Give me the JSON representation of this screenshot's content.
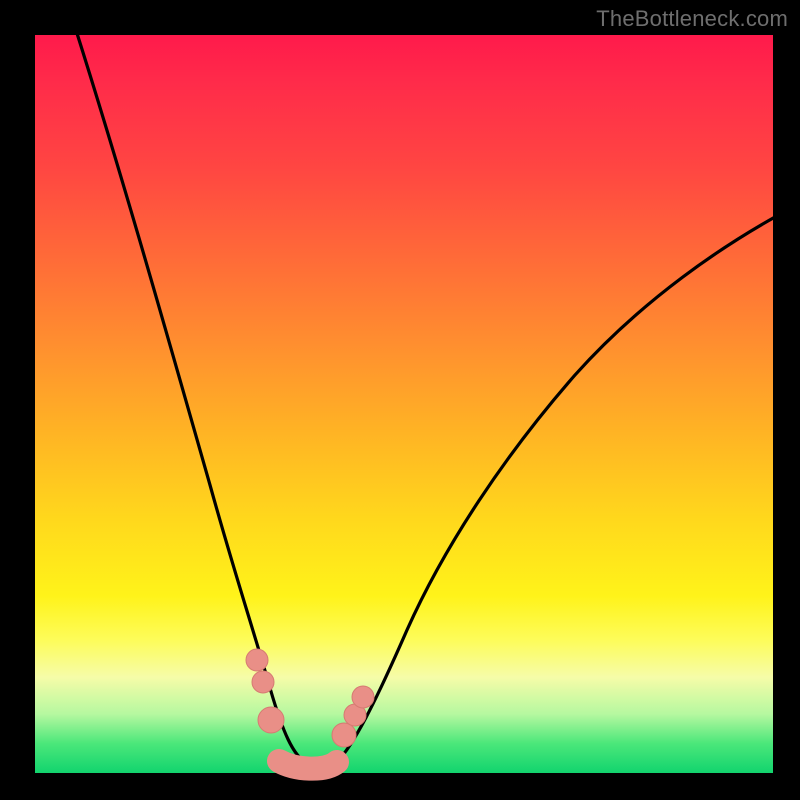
{
  "watermark": "TheBottleneck.com",
  "colors": {
    "frame": "#000000",
    "curve": "#000000",
    "marker_fill": "#e98f87",
    "marker_stroke": "#d67a72",
    "gradient_top": "#ff1a4b",
    "gradient_bottom": "#12d46e"
  },
  "chart_data": {
    "type": "line",
    "title": "",
    "xlabel": "",
    "ylabel": "",
    "xlim": [
      0,
      100
    ],
    "ylim": [
      0,
      100
    ],
    "grid": false,
    "series": [
      {
        "name": "curve-left",
        "x": [
          10,
          14,
          18,
          22,
          25,
          27,
          29,
          31,
          32.5,
          33.5,
          35
        ],
        "y": [
          100,
          81,
          64,
          49,
          36,
          27,
          20,
          13,
          7,
          4,
          1
        ]
      },
      {
        "name": "curve-right",
        "x": [
          40,
          42,
          44,
          47,
          50,
          55,
          60,
          67,
          75,
          85,
          95,
          100
        ],
        "y": [
          1,
          4,
          8,
          14,
          20,
          29,
          37,
          46,
          54,
          63,
          71,
          75
        ]
      }
    ],
    "markers": [
      {
        "x": 30.5,
        "y": 15,
        "r": 1.6
      },
      {
        "x": 31.3,
        "y": 12,
        "r": 1.6
      },
      {
        "x": 32.3,
        "y": 6.5,
        "r": 2.0
      },
      {
        "x": 33.5,
        "y": 3.2,
        "r": 2.4
      },
      {
        "x": 35.0,
        "y": 1.4,
        "r": 2.4
      },
      {
        "x": 36.8,
        "y": 0.8,
        "r": 2.4
      },
      {
        "x": 38.6,
        "y": 0.9,
        "r": 2.4
      },
      {
        "x": 40.2,
        "y": 1.6,
        "r": 2.4
      },
      {
        "x": 41.6,
        "y": 3.6,
        "r": 2.0
      },
      {
        "x": 43.2,
        "y": 7.0,
        "r": 1.6
      },
      {
        "x": 44.2,
        "y": 9.5,
        "r": 1.6
      }
    ]
  }
}
